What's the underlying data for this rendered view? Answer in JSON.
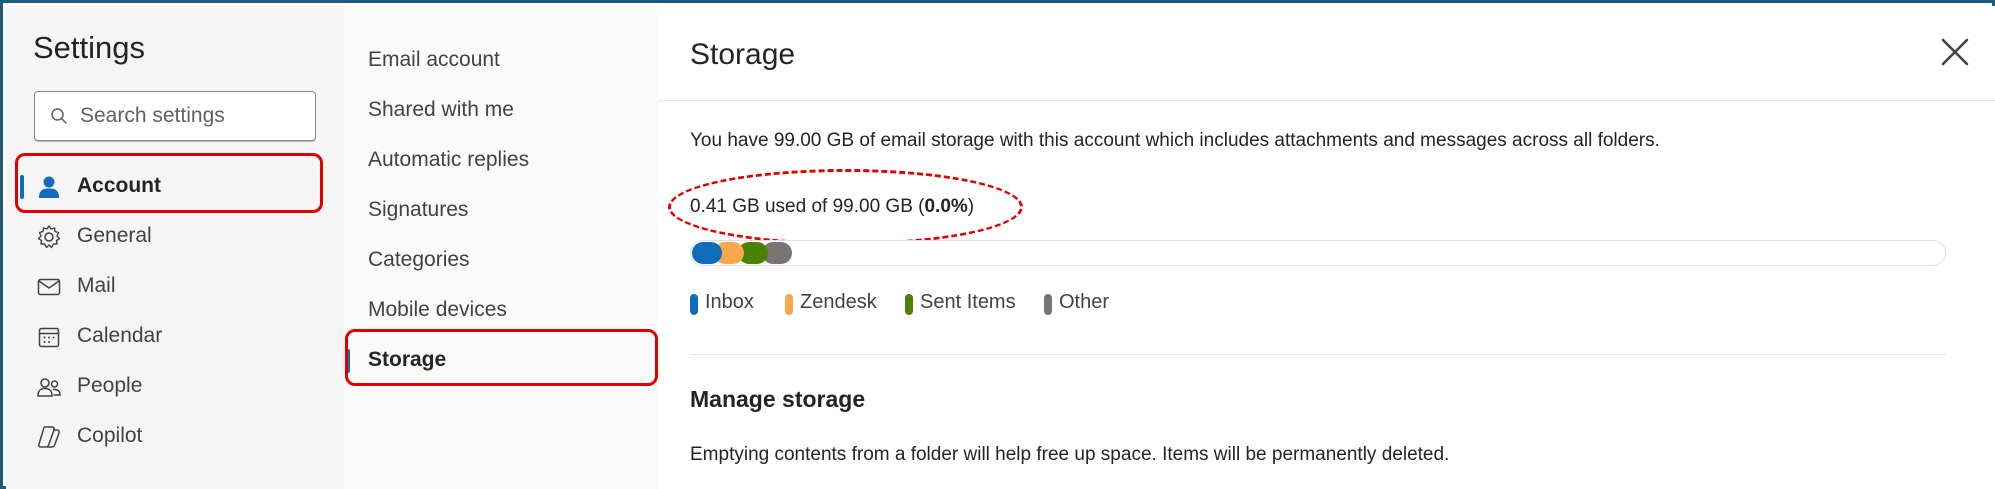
{
  "settings": {
    "title": "Settings"
  },
  "search": {
    "placeholder": "Search settings"
  },
  "nav": {
    "items": [
      {
        "label": "Account",
        "icon": "person-icon",
        "active": true
      },
      {
        "label": "General",
        "icon": "gear-icon"
      },
      {
        "label": "Mail",
        "icon": "mail-icon"
      },
      {
        "label": "Calendar",
        "icon": "calendar-icon"
      },
      {
        "label": "People",
        "icon": "people-icon"
      },
      {
        "label": "Copilot",
        "icon": "copilot-icon"
      }
    ]
  },
  "subnav": {
    "items": [
      {
        "label": "Email account"
      },
      {
        "label": "Shared with me"
      },
      {
        "label": "Automatic replies"
      },
      {
        "label": "Signatures"
      },
      {
        "label": "Categories"
      },
      {
        "label": "Mobile devices"
      },
      {
        "label": "Storage",
        "active": true
      }
    ]
  },
  "storage": {
    "title": "Storage",
    "description": "You have 99.00 GB of email storage with this account which includes attachments and messages across all folders.",
    "usage_text": "0.41 GB used of 99.00 GB (",
    "usage_percent": "0.0%",
    "usage_close": ")",
    "legend": [
      {
        "label": "Inbox",
        "color": "#0f6cbd"
      },
      {
        "label": "Zendesk",
        "color": "#f7a84a"
      },
      {
        "label": "Sent Items",
        "color": "#498205"
      },
      {
        "label": "Other",
        "color": "#7a7574"
      }
    ]
  },
  "manage": {
    "title": "Manage storage",
    "description": "Emptying contents from a folder will help free up space. Items will be permanently deleted."
  },
  "colors": {
    "accent": "#0f6cbd",
    "highlight": "#e00000",
    "frame": "#1f5a7a"
  }
}
